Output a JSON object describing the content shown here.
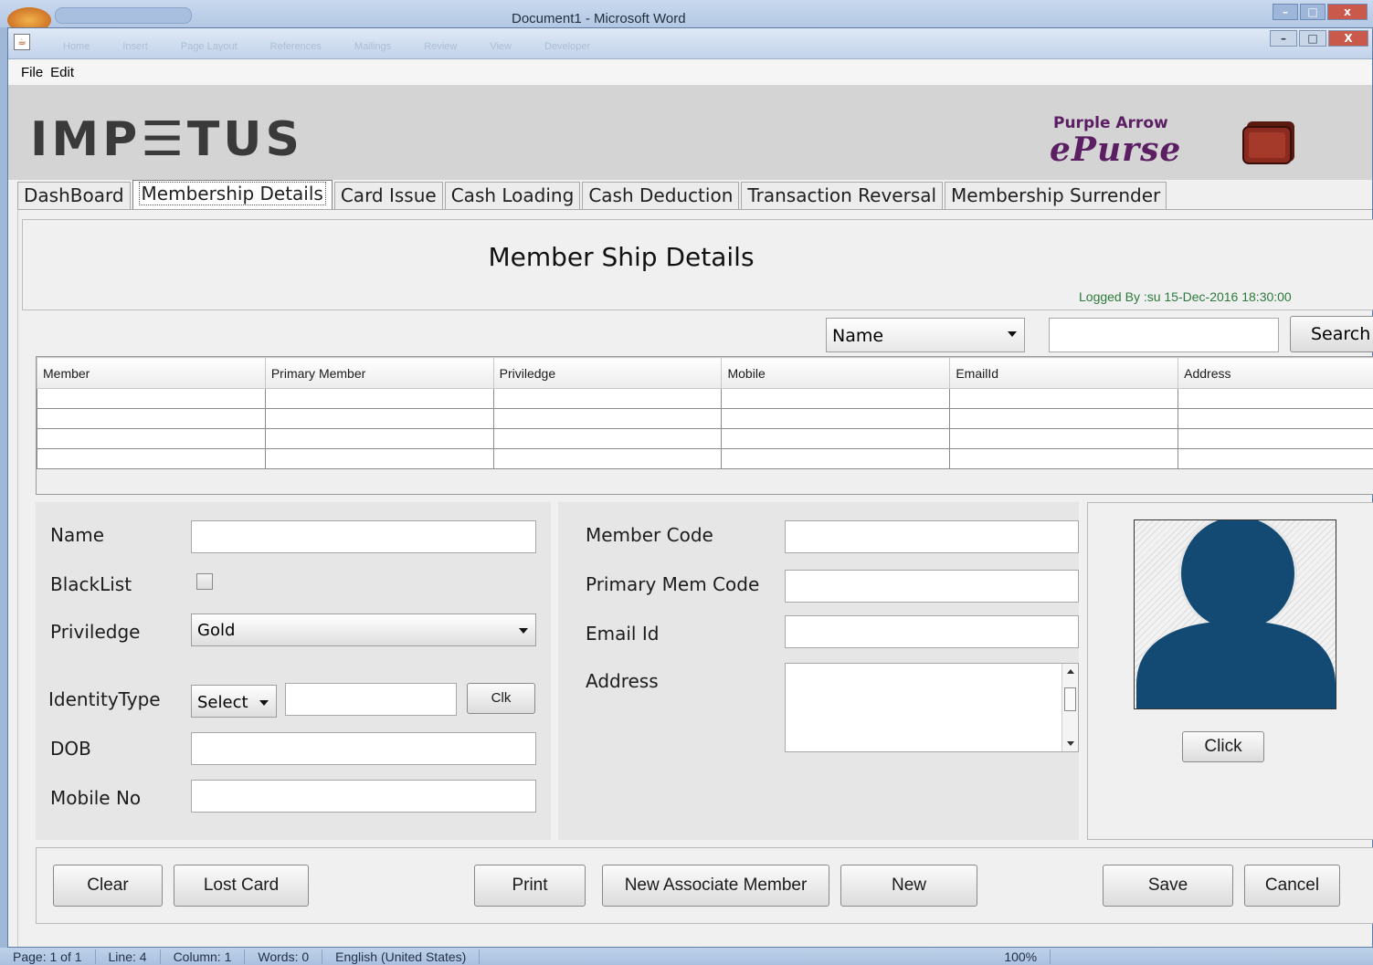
{
  "word": {
    "title": "Document1 - Microsoft Word",
    "ribbon_tabs": [
      "Home",
      "Insert",
      "Page Layout",
      "References",
      "Mailings",
      "Review",
      "View",
      "Developer"
    ],
    "status": [
      "Page: 1 of 1",
      "Line: 4",
      "Column: 1",
      "Words: 0",
      "English (United States)",
      "100%"
    ]
  },
  "menu": {
    "file": "File",
    "edit": "Edit"
  },
  "header": {
    "logo": "IMP☰TUS",
    "brand_top": "Purple Arrow",
    "brand_bottom": "ePurse"
  },
  "tabs": [
    {
      "label": "DashBoard"
    },
    {
      "label": "Membership Details"
    },
    {
      "label": "Card Issue"
    },
    {
      "label": "Cash Loading"
    },
    {
      "label": "Cash Deduction"
    },
    {
      "label": "Transaction Reversal"
    },
    {
      "label": "Membership Surrender"
    }
  ],
  "page": {
    "title": "Member Ship Details",
    "logged_by": "Logged By :su    15-Dec-2016 18:30:00"
  },
  "search": {
    "field_selected": "Name",
    "query": "",
    "button_label": "Search"
  },
  "table": {
    "columns": [
      "Member",
      "Primary Member",
      "Priviledge",
      "Mobile",
      "EmailId",
      "Address"
    ],
    "rows": [
      [
        "",
        "",
        "",
        "",
        "",
        ""
      ],
      [
        "",
        "",
        "",
        "",
        "",
        ""
      ],
      [
        "",
        "",
        "",
        "",
        "",
        ""
      ],
      [
        "",
        "",
        "",
        "",
        "",
        ""
      ]
    ]
  },
  "form_left": {
    "name_label": "Name",
    "name_value": "",
    "blacklist_label": "BlackList",
    "blacklist_checked": false,
    "priviledge_label": "Priviledge",
    "priviledge_value": "Gold",
    "identity_label": "IdentityType",
    "identity_select": "Select",
    "identity_value": "",
    "clk_button": "Clk",
    "dob_label": "DOB",
    "dob_value": "",
    "mobile_label": "Mobile No",
    "mobile_value": ""
  },
  "form_mid": {
    "member_code_label": "Member Code",
    "member_code_value": "",
    "primary_code_label": "Primary Mem Code",
    "primary_code_value": "",
    "email_label": "Email Id",
    "email_value": "",
    "address_label": "Address",
    "address_value": ""
  },
  "photo": {
    "click_button": "Click"
  },
  "actions": {
    "clear": "Clear",
    "lost_card": "Lost Card",
    "print": "Print",
    "new_associate": "New Associate Member",
    "new": "New",
    "save": "Save",
    "cancel": "Cancel"
  },
  "colors": {
    "avatar": "#134a73",
    "logged_by": "#2c7a3c",
    "brand": "#5b1e63",
    "wallet": "#8b2a1e"
  }
}
